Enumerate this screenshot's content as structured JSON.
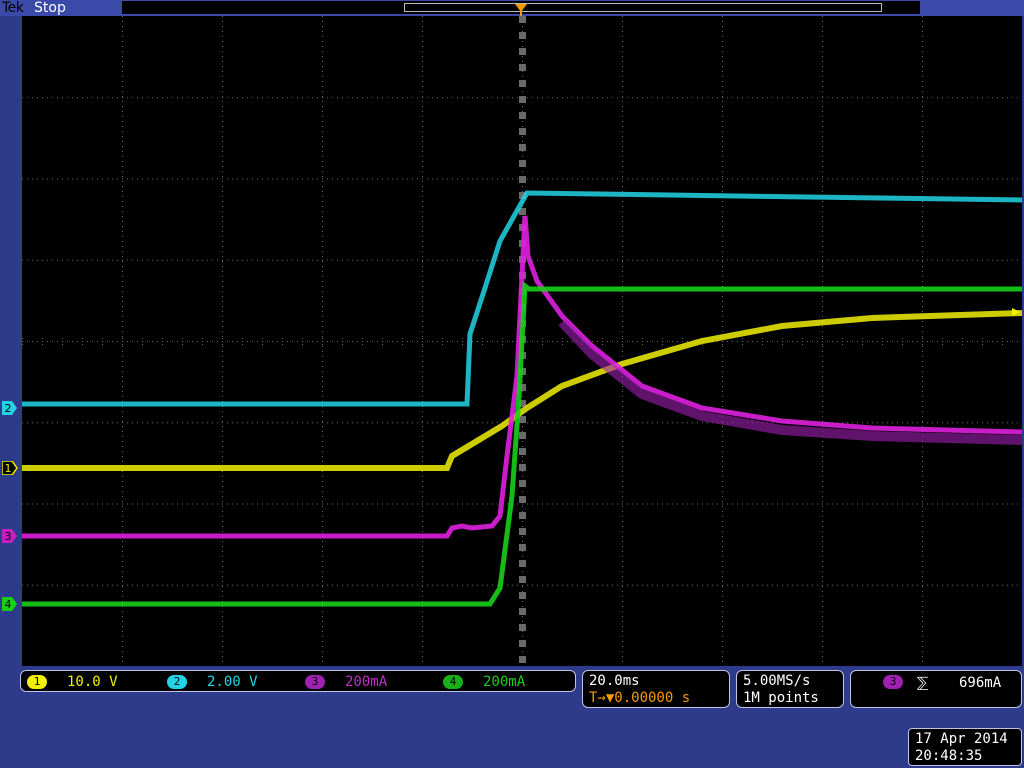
{
  "header": {
    "logo": "Tek",
    "status": "Stop"
  },
  "trigger_marker": "T",
  "channels": [
    {
      "id": "1",
      "scale": "10.0 V",
      "color": "#f0f000"
    },
    {
      "id": "2",
      "scale": "2.00 V",
      "color": "#22d3e6"
    },
    {
      "id": "3",
      "scale": "200mA",
      "color": "#e020e0"
    },
    {
      "id": "4",
      "scale": "200mA",
      "color": "#18d018"
    }
  ],
  "timebase": {
    "scale": "20.0ms",
    "position": "T→▼0.00000 s"
  },
  "acquisition": {
    "rate": "5.00MS/s",
    "length": "1M points"
  },
  "trigger": {
    "source": "3",
    "slope": "⅀",
    "level": "696mA"
  },
  "datetime": {
    "date": "17 Apr 2014",
    "time": "20:48:35"
  },
  "colors": {
    "frame": "#2e3a8a",
    "grid": "#6a6a6a",
    "accent": "#f59a00"
  }
}
